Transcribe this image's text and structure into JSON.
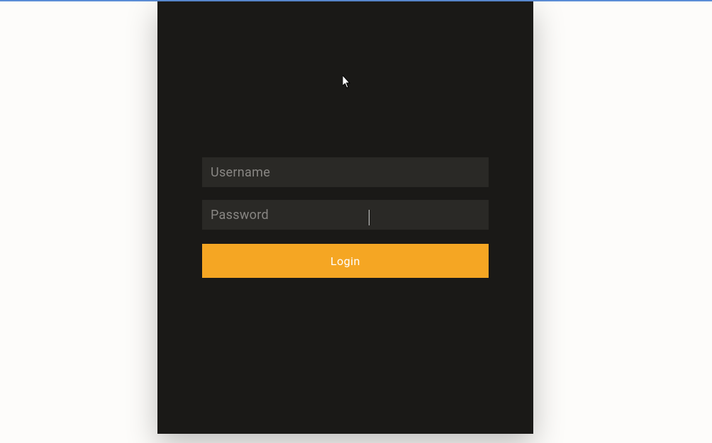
{
  "login": {
    "username_placeholder": "Username",
    "username_value": "",
    "password_placeholder": "Password",
    "password_value": "",
    "button_label": "Login"
  },
  "colors": {
    "card_bg": "#1a1917",
    "input_bg": "#2a2926",
    "button_bg": "#f5a623",
    "placeholder": "#888683"
  }
}
